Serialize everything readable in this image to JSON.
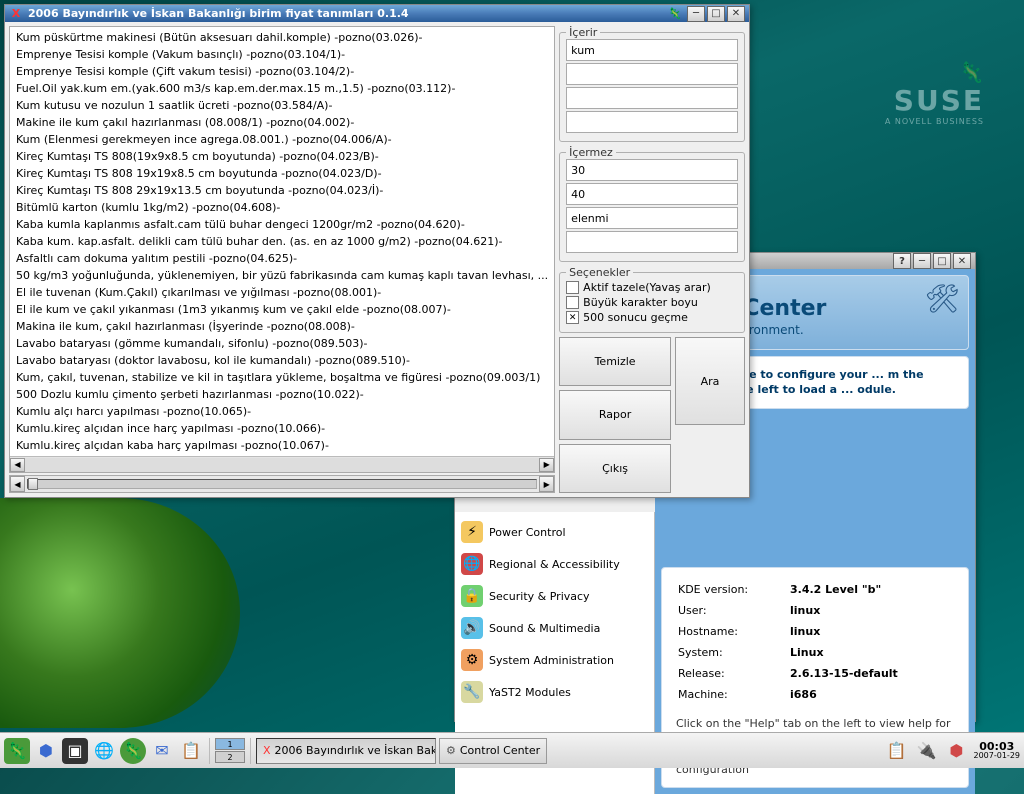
{
  "app_window": {
    "title": "2006 Bayındırlık ve İskan Bakanlığı birim fiyat tanımları 0.1.4",
    "list_items": [
      "Kum püskürtme makinesi (Bütün aksesuarı dahil.komple) -pozno(03.026)-",
      "Emprenye Tesisi komple (Vakum basınçlı) -pozno(03.104/1)-",
      "Emprenye Tesisi komple (Çift vakum tesisi) -pozno(03.104/2)-",
      "Fuel.Oil yak.kum em.(yak.600 m3/s kap.em.der.max.15 m.,1.5) -pozno(03.112)-",
      "Kum kutusu ve nozulun 1 saatlik ücreti -pozno(03.584/A)-",
      "Makine ile kum çakıl hazırlanması (08.008/1) -pozno(04.002)-",
      "Kum (Elenmesi gerekmeyen ince agrega.08.001.) -pozno(04.006/A)-",
      "Kireç Kumtaşı TS 808(19x9x8.5 cm boyutunda) -pozno(04.023/B)-",
      "Kireç Kumtaşı TS 808 19x19x8.5 cm boyutunda -pozno(04.023/D)-",
      "Kireç Kumtaşı TS 808 29x19x13.5 cm boyutunda -pozno(04.023/İ)-",
      "Bitümlü karton (kumlu 1kg/m2) -pozno(04.608)-",
      "Kaba kumla kaplanmıs asfalt.cam tülü buhar dengeci 1200gr/m2 -pozno(04.620)-",
      "Kaba kum. kap.asfalt. delikli cam tülü buhar den. (as. en az 1000 g/m2) -pozno(04.621)-",
      "Asfaltlı cam dokuma yalıtım pestili -pozno(04.625)-",
      "50 kg/m3 yoğunluğunda, yüklenemiyen, bir yüzü fabrikasında cam kumaş kaplı tavan levhası, ...",
      "El ile tuvenan (Kum.Çakıl) çıkarılması ve yığılması -pozno(08.001)-",
      "El ile kum ve çakıl yıkanması (1m3 yıkanmış kum ve çakıl elde -pozno(08.007)-",
      "Makina ile kum, çakıl hazırlanması (İşyerinde -pozno(08.008)-",
      "Lavabo bataryası (gömme kumandalı, sifonlu) -pozno(089.503)-",
      "Lavabo bataryası (doktor lavabosu, kol ile kumandalı) -pozno(089.510)-",
      "Kum, çakıl, tuvenan, stabilize ve kil in taşıtlara yükleme, boşaltma ve figüresi -pozno(09.003/1)",
      "500 Dozlu kumlu çimento şerbeti hazırlanması -pozno(10.022)-",
      "Kumlu alçı harcı yapılması -pozno(10.065)-",
      "Kumlu.kireç alçıdan ince harç yapılması -pozno(10.066)-",
      "Kumlu.kireç alçıdan kaba harç yapılması -pozno(10.067)-"
    ],
    "groups": {
      "contains": {
        "label": "İçerir",
        "fields": [
          "kum",
          "",
          "",
          ""
        ]
      },
      "excludes": {
        "label": "İçermez",
        "fields": [
          "30",
          "40",
          "elenmi",
          ""
        ]
      },
      "options": {
        "label": "Seçenekler",
        "items": [
          {
            "label": "Aktif tazele(Yavaş arar)",
            "checked": false
          },
          {
            "label": "Büyük karakter boyu",
            "checked": false
          },
          {
            "label": "500 sonucu geçme",
            "checked": true
          }
        ]
      }
    },
    "buttons": {
      "clear": "Temizle",
      "report": "Rapor",
      "exit": "Çıkış",
      "search": "Ara"
    }
  },
  "cc_window": {
    "title_partial": "ntrol Center",
    "title_sub": "lesktop environment.",
    "intro_partial": "central place to configure your ... m the index on the left to load a ... odule.",
    "help_btn": "?",
    "sidebar": [
      {
        "label": "Power Control",
        "icon": "⚡",
        "bg": "#f4c860"
      },
      {
        "label": "Regional & Accessibility",
        "icon": "🌐",
        "bg": "#d04848"
      },
      {
        "label": "Security & Privacy",
        "icon": "🔒",
        "bg": "#70d070"
      },
      {
        "label": "Sound & Multimedia",
        "icon": "🔊",
        "bg": "#58c0e8"
      },
      {
        "label": "System Administration",
        "icon": "⚙",
        "bg": "#f0a060"
      },
      {
        "label": "YaST2 Modules",
        "icon": "🔧",
        "bg": "#d8d8a0"
      }
    ],
    "info": {
      "rows": [
        {
          "k": "KDE version:",
          "v": "3.4.2 Level \"b\""
        },
        {
          "k": "User:",
          "v": "linux"
        },
        {
          "k": "Hostname:",
          "v": "linux"
        },
        {
          "k": "System:",
          "v": "Linux"
        },
        {
          "k": "Release:",
          "v": "2.6.13-15-default"
        },
        {
          "k": "Machine:",
          "v": "i686"
        }
      ],
      "hint": "Click on the \"Help\" tab on the left to view help for the active control module. Use the \"Search\" tab if you are unsure where to look for a particular configuration"
    }
  },
  "taskbar": {
    "tasks": [
      {
        "label": "2006 Bayındırlık ve İskan Bak",
        "active": true
      },
      {
        "label": "Control Center",
        "active": false
      }
    ],
    "clock": {
      "time": "00:03",
      "date": "2007-01-29"
    }
  }
}
